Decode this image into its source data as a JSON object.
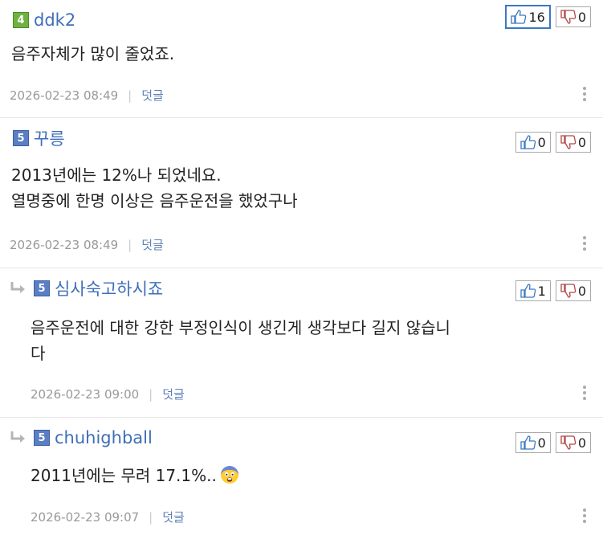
{
  "comments": [
    {
      "level": "4",
      "nickname": "ddk2",
      "lines": [
        "음주자체가 많이 줄었죠."
      ],
      "datetime": "2026-02-23 08:49",
      "reply_label": "덧글",
      "up": "16",
      "down": "0",
      "is_reply": false
    },
    {
      "level": "5",
      "nickname": "꾸릉",
      "lines": [
        "2013년에는 12%나 되었네요.",
        "열명중에 한명 이상은 음주운전을 했었구나"
      ],
      "datetime": "2026-02-23 08:49",
      "reply_label": "덧글",
      "up": "0",
      "down": "0",
      "is_reply": false
    },
    {
      "level": "5",
      "nickname": "심사숙고하시죠",
      "lines": [
        "음주운전에 대한 강한 부정인식이 생긴게 생각보다 길지 않습니",
        "다"
      ],
      "datetime": "2026-02-23 09:00",
      "reply_label": "덧글",
      "up": "1",
      "down": "0",
      "is_reply": true
    },
    {
      "level": "5",
      "nickname": "chuhighball",
      "lines": [
        "2011년에는 무려 17.1%.."
      ],
      "emoji": "fearful-face-emoji",
      "datetime": "2026-02-23 09:07",
      "reply_label": "덧글",
      "up": "0",
      "down": "0",
      "is_reply": true
    }
  ],
  "icons": {
    "thumbs_up": "thumbs-up-icon",
    "thumbs_down": "thumbs-down-icon",
    "reply_arrow": "reply-arrow-icon",
    "more": "more-vertical-icon"
  },
  "colors": {
    "nickname": "#3f6fb8",
    "meta": "#999999",
    "reply_link": "#5e81b8",
    "active_vote_border": "#3a78c2",
    "level4": "#6fb23f",
    "level5": "#5b7fc4"
  }
}
